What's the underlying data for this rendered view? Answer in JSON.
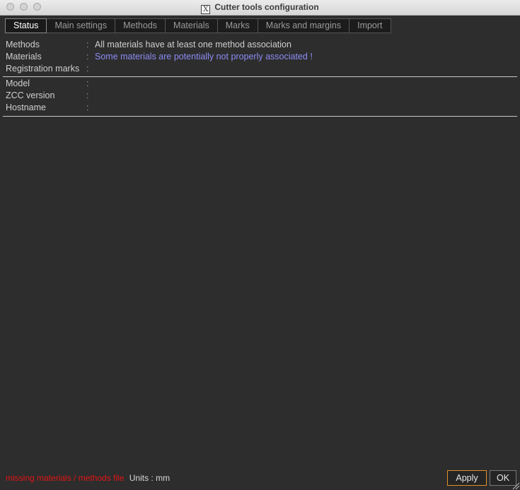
{
  "window": {
    "title": "Cutter tools configuration",
    "x_icon_glyph": "X"
  },
  "tabs": [
    {
      "label": "Status",
      "active": true
    },
    {
      "label": "Main settings",
      "active": false
    },
    {
      "label": "Methods",
      "active": false
    },
    {
      "label": "Materials",
      "active": false
    },
    {
      "label": "Marks",
      "active": false
    },
    {
      "label": "Marks and margins",
      "active": false
    },
    {
      "label": "Import",
      "active": false
    }
  ],
  "status": {
    "separator": ":",
    "rows": [
      {
        "label": "Methods",
        "value": "All materials have at least one method association"
      },
      {
        "label": "Materials",
        "value": "Some materials are potentially not properly associated !"
      },
      {
        "label": "Registration marks",
        "value": ""
      },
      {
        "label": "Model",
        "value": ""
      },
      {
        "label": "ZCC version",
        "value": ""
      },
      {
        "label": "Hostname",
        "value": ""
      }
    ]
  },
  "footer": {
    "warning": "missing materials / methods file",
    "units": "Units : mm"
  },
  "buttons": {
    "apply": "Apply",
    "ok": "OK"
  },
  "colors": {
    "background": "#2d2d2d",
    "warning_text": "#e21414",
    "link_value": "#8c8cf5",
    "apply_focus": "#e0902a"
  }
}
